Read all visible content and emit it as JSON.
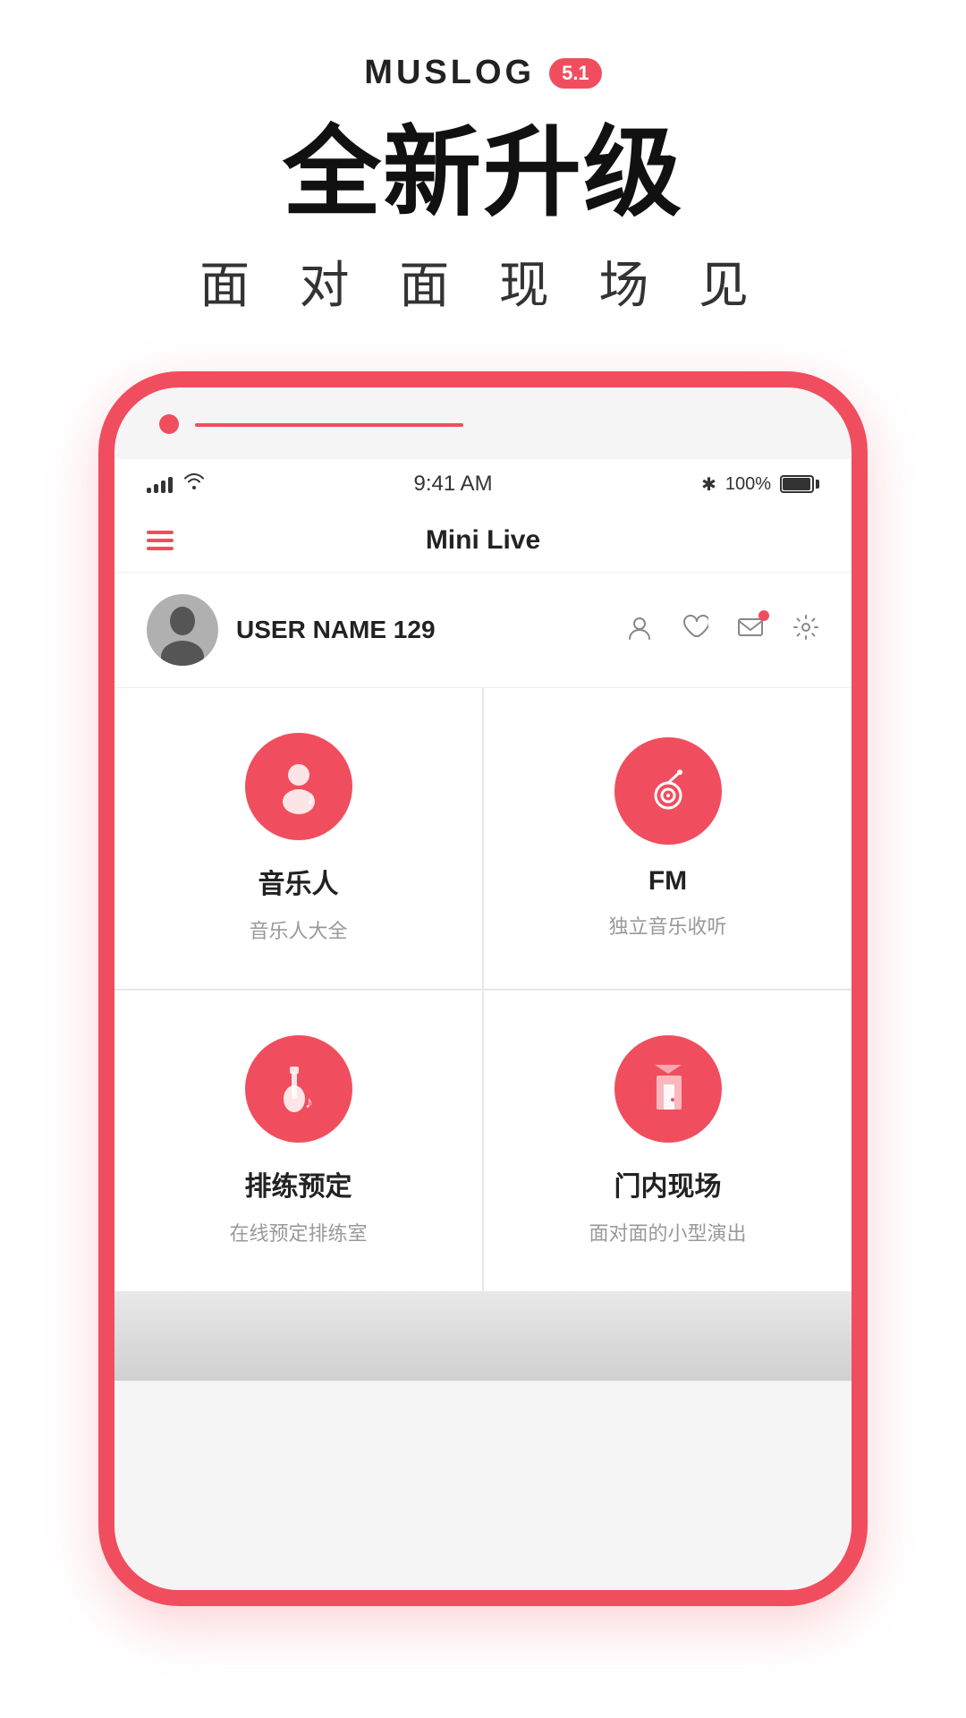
{
  "brand": {
    "name": "MUSLOG",
    "version": "5.1",
    "headline": "全新升级",
    "subheadline": "面 对 面    现 场 见"
  },
  "status_bar": {
    "time": "9:41 AM",
    "battery_percent": "100%",
    "bluetooth": "✱"
  },
  "app_bar": {
    "title": "Mini Live"
  },
  "user": {
    "name": "USER NAME 129"
  },
  "features": [
    {
      "title": "音乐人",
      "subtitle": "音乐人大全",
      "icon": "musician"
    },
    {
      "title": "FM",
      "subtitle": "独立音乐收听",
      "icon": "radio"
    },
    {
      "title": "排练预定",
      "subtitle": "在线预定排练室",
      "icon": "rehearsal"
    },
    {
      "title": "门内现场",
      "subtitle": "面对面的小型演出",
      "icon": "venue"
    }
  ]
}
